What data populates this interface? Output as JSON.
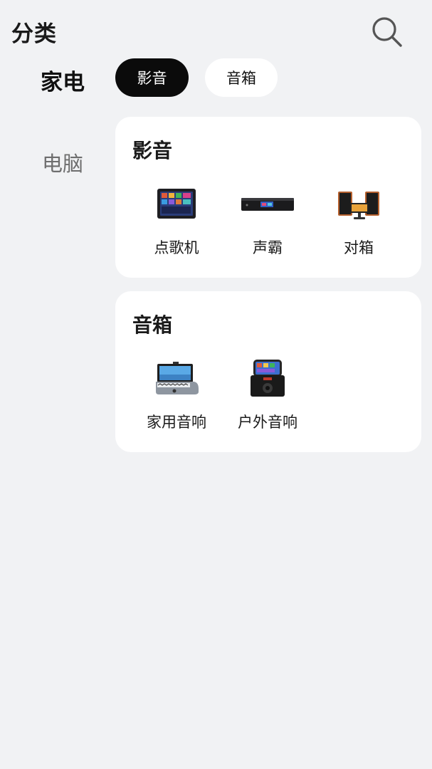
{
  "header": {
    "title": "分类",
    "search_icon": "search-icon"
  },
  "sidebar": {
    "items": [
      {
        "label": "家电",
        "active": true
      },
      {
        "label": "电脑",
        "active": false
      }
    ]
  },
  "tabs": [
    {
      "label": "影音",
      "active": true
    },
    {
      "label": "音箱",
      "active": false
    }
  ],
  "sections": [
    {
      "title": "影音",
      "products": [
        {
          "label": "点歌机",
          "icon": "karaoke-machine-icon"
        },
        {
          "label": "声霸",
          "icon": "soundbar-icon"
        },
        {
          "label": "对箱",
          "icon": "speaker-pair-icon"
        }
      ]
    },
    {
      "title": "音箱",
      "products": [
        {
          "label": "家用音响",
          "icon": "home-speaker-icon"
        },
        {
          "label": "户外音响",
          "icon": "outdoor-speaker-icon"
        }
      ]
    }
  ],
  "colors": {
    "background": "#f1f2f4",
    "card": "#ffffff",
    "active_tab": "#0b0b0b",
    "inactive_sidebar": "#6e6e6e"
  }
}
